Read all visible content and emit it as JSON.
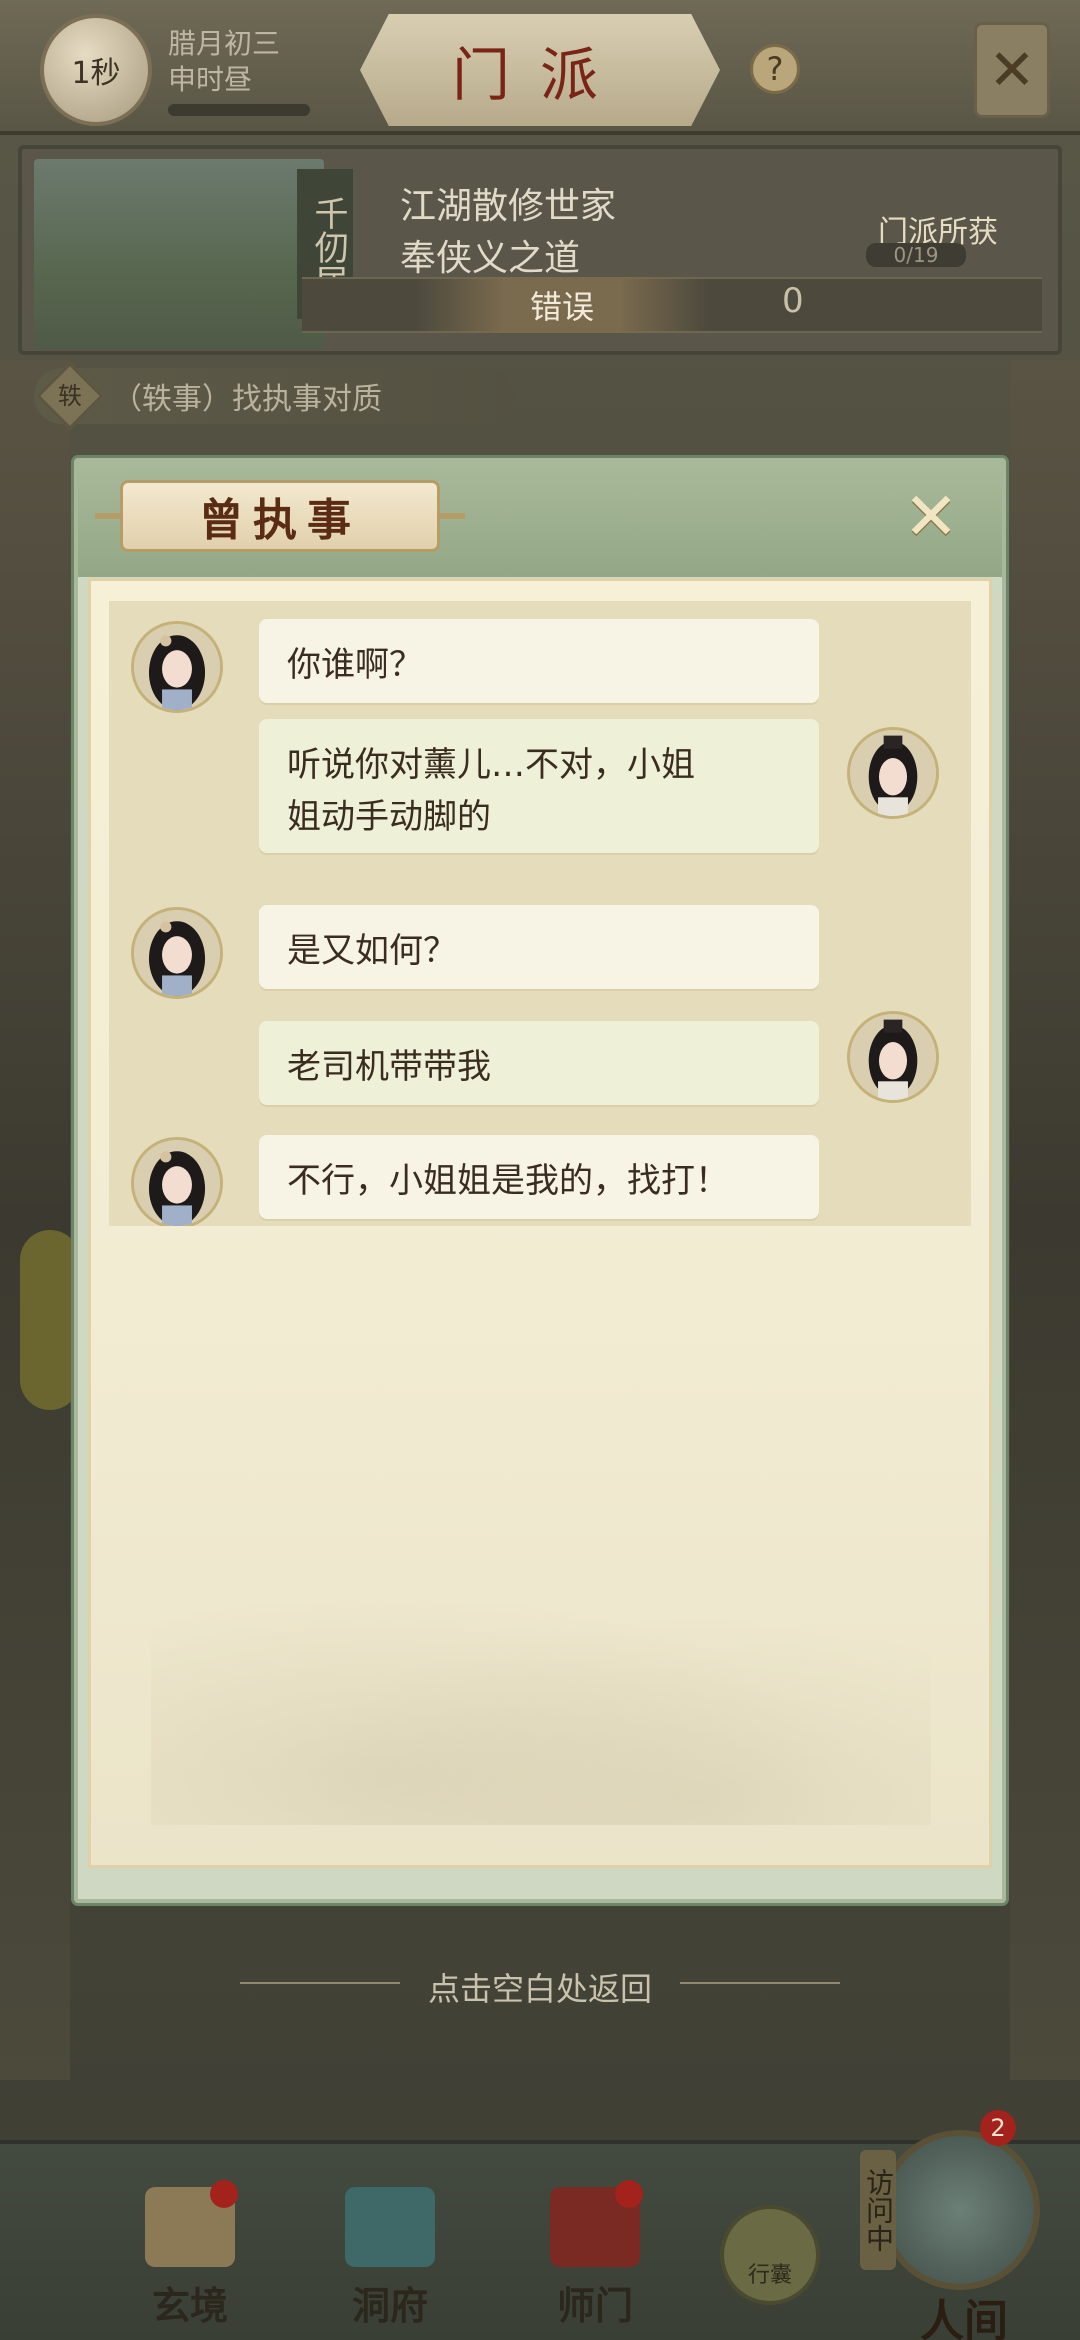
{
  "topbar": {
    "timer_label": "1秒",
    "date_line1": "腊月初三",
    "date_line2": "申时昼",
    "title": "门派",
    "help_label": "?",
    "close_icon": "close-icon"
  },
  "sect": {
    "name_vertical": "千仞居",
    "desc_line1": "江湖散修世家",
    "desc_line2": "奉侠义之道",
    "reward_label": "门派所获",
    "reward_count": "0/19",
    "status_text": "错误",
    "money": "0"
  },
  "event": {
    "badge": "轶",
    "text": "（轶事）找执事对质"
  },
  "dialog": {
    "title": "曾执事",
    "close_icon": "close-icon",
    "messages": [
      {
        "speaker": "npc",
        "text": "你谁啊？"
      },
      {
        "speaker": "player",
        "text_line1": "听说你对薰儿…不对，小姐",
        "text_line2": "姐动手动脚的"
      },
      {
        "speaker": "npc",
        "text": "是又如何？"
      },
      {
        "speaker": "player",
        "text": "老司机带带我"
      },
      {
        "speaker": "npc",
        "text": "不行，小姐姐是我的，找打！"
      }
    ],
    "hint": "点击空白处返回"
  },
  "nav": {
    "items": [
      {
        "label": "玄境",
        "icon": "scroll-icon"
      },
      {
        "label": "洞府",
        "icon": "pavilion-icon"
      },
      {
        "label": "师门",
        "icon": "banner-icon"
      }
    ],
    "bag_label": "行囊",
    "world_label": "人间",
    "world_tag": "访问中",
    "world_badge": "2"
  },
  "colors": {
    "dialog_frame": "#a8b99a",
    "bubble": "#f7f3e5",
    "title_red": "#7a2418"
  }
}
